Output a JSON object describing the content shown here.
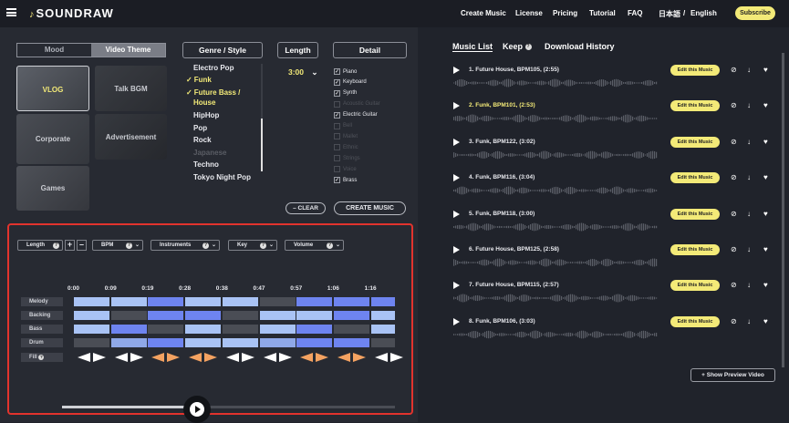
{
  "header": {
    "logo": "SOUNDRAW",
    "nav": [
      "Create Music",
      "License",
      "Pricing",
      "Tutorial",
      "FAQ",
      "日本語",
      "/",
      "English"
    ],
    "subscribe": "Subscribe"
  },
  "theme": {
    "tabs": [
      "Mood",
      "Video Theme"
    ],
    "active_tab": "Video Theme",
    "tiles": [
      "VLOG",
      "Talk BGM",
      "Corporate",
      "Advertisement",
      "Games"
    ],
    "selected_tile": "VLOG"
  },
  "genre": {
    "title": "Genre / Style",
    "items": [
      {
        "label": "Electro Pop",
        "state": "normal"
      },
      {
        "label": "Funk",
        "state": "checked"
      },
      {
        "label": "Future Bass /",
        "state": "checked"
      },
      {
        "label": "House",
        "state": "checked-cont"
      },
      {
        "label": "HipHop",
        "state": "normal"
      },
      {
        "label": "Pop",
        "state": "normal"
      },
      {
        "label": "Rock",
        "state": "normal"
      },
      {
        "label": "Japanese",
        "state": "dim"
      },
      {
        "label": "Techno",
        "state": "normal"
      },
      {
        "label": "Tokyo Night Pop",
        "state": "normal"
      }
    ]
  },
  "length": {
    "title": "Length",
    "value": "3:00"
  },
  "detail": {
    "title": "Detail",
    "instruments": [
      {
        "label": "Piano",
        "checked": true,
        "dim": false
      },
      {
        "label": "Keyboard",
        "checked": true,
        "dim": false
      },
      {
        "label": "Synth",
        "checked": true,
        "dim": false
      },
      {
        "label": "Acoustic Guitar",
        "checked": false,
        "dim": true
      },
      {
        "label": "Electric Guitar",
        "checked": true,
        "dim": false
      },
      {
        "label": "Bell",
        "checked": false,
        "dim": true
      },
      {
        "label": "Mallet",
        "checked": false,
        "dim": true
      },
      {
        "label": "Ethnic",
        "checked": false,
        "dim": true
      },
      {
        "label": "Strings",
        "checked": false,
        "dim": true
      },
      {
        "label": "Voice",
        "checked": false,
        "dim": true
      },
      {
        "label": "Brass",
        "checked": true,
        "dim": false
      }
    ]
  },
  "actions": {
    "clear": "CLEAR",
    "create": "CREATE MUSIC"
  },
  "editor": {
    "dropdowns": [
      "Length",
      "BPM",
      "Instruments",
      "Key",
      "Volume"
    ],
    "timeline": [
      "0:00",
      "0:09",
      "0:19",
      "0:28",
      "0:38",
      "0:47",
      "0:57",
      "1:06",
      "1:16"
    ],
    "rows": [
      {
        "label": "Melody",
        "levels": [
          2,
          2,
          3,
          2,
          2,
          0,
          3,
          3,
          3
        ]
      },
      {
        "label": "Backing",
        "levels": [
          2,
          0,
          3,
          3,
          0,
          2,
          2,
          3,
          2
        ]
      },
      {
        "label": "Bass",
        "levels": [
          2,
          3,
          0,
          2,
          0,
          2,
          3,
          0,
          2
        ]
      },
      {
        "label": "Drum",
        "levels": [
          0,
          1,
          3,
          2,
          2,
          1,
          3,
          3,
          0
        ]
      }
    ],
    "fill_label": "Fill",
    "progress": 0.37,
    "colors": {
      "level0": "#4a4d55",
      "level1": "#8fa8e8",
      "level2": "#a9c3f5",
      "level3": "#6e84f0"
    }
  },
  "music_list": {
    "tabs": [
      "Music List",
      "Keep",
      "Download History"
    ],
    "tracks": [
      {
        "title": "1. Future House, BPM105, (2:55)",
        "active": false
      },
      {
        "title": "2. Funk, BPM101, (2:53)",
        "active": true
      },
      {
        "title": "3. Funk, BPM122, (3:02)",
        "active": false
      },
      {
        "title": "4. Funk, BPM116, (3:04)",
        "active": false
      },
      {
        "title": "5. Funk, BPM118, (3:00)",
        "active": false
      },
      {
        "title": "6. Future House, BPM125, (2:58)",
        "active": false
      },
      {
        "title": "7. Future House, BPM115, (2:57)",
        "active": false
      },
      {
        "title": "8. Funk, BPM106, (3:03)",
        "active": false
      }
    ],
    "edit_label": "Edit this Music",
    "preview": "Show Preview Video"
  }
}
